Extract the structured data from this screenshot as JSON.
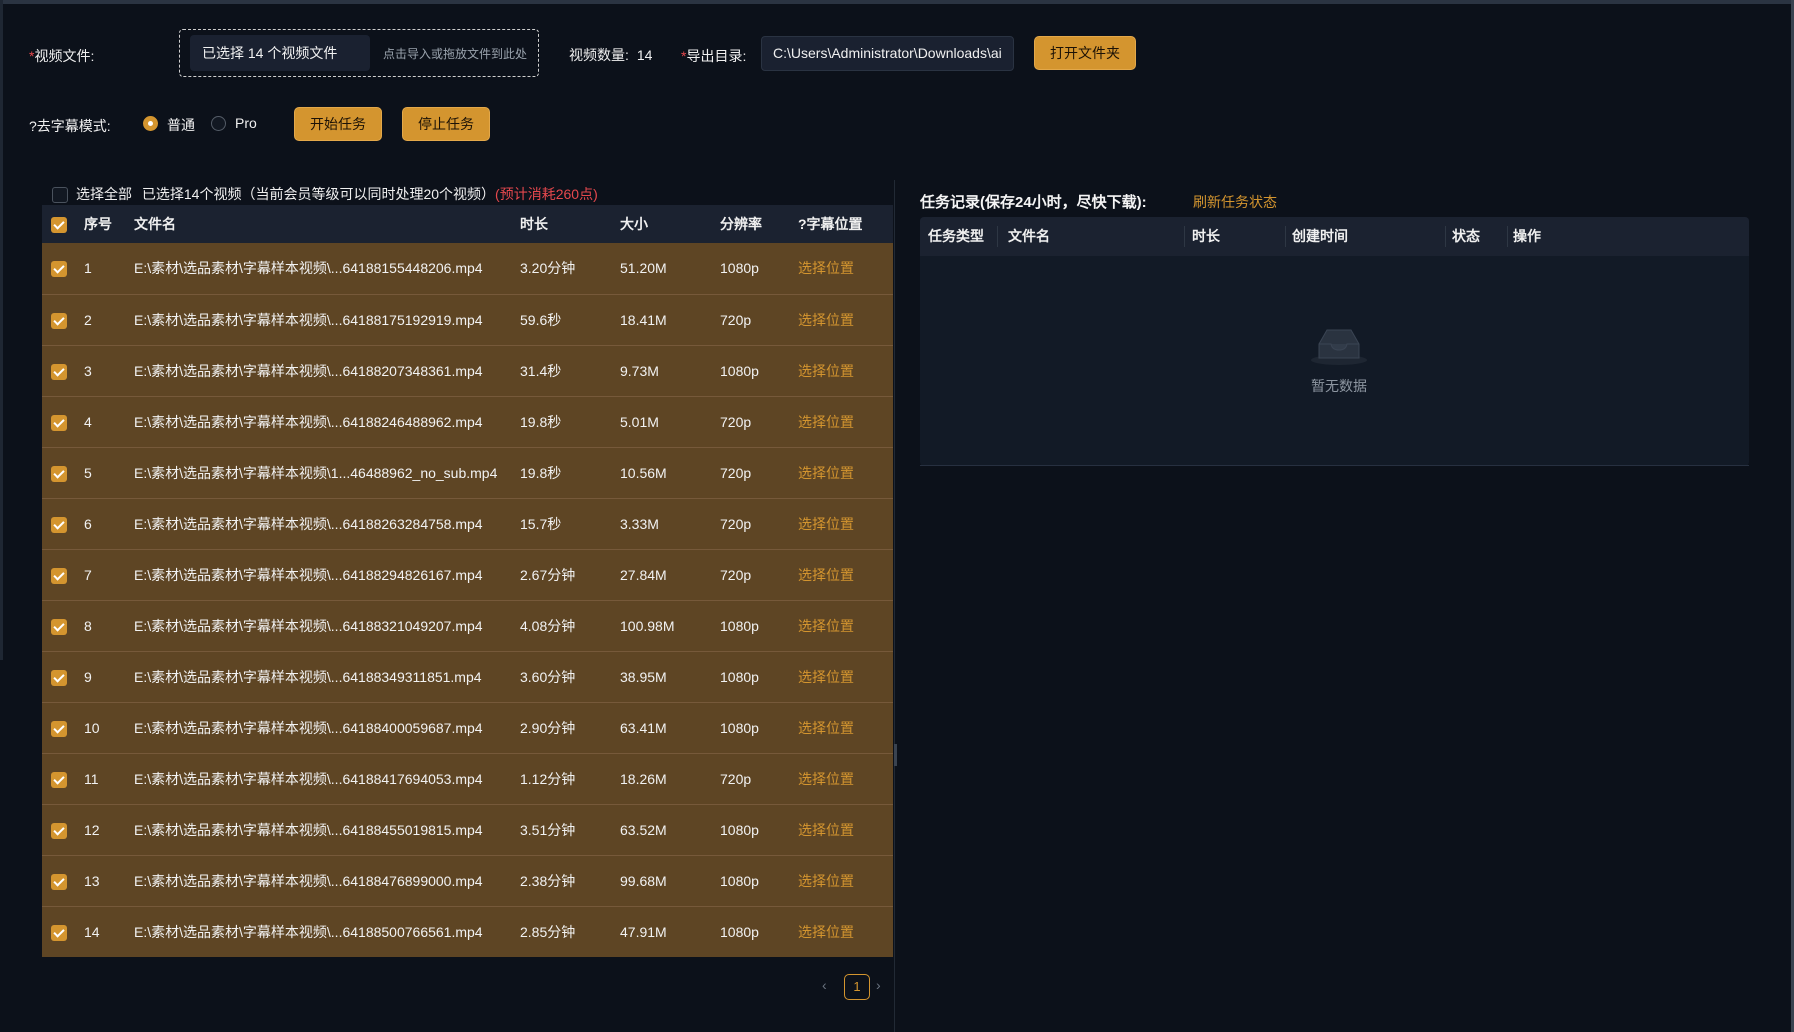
{
  "header": {
    "video_file_label": "视频文件:",
    "video_file_required": "*",
    "selected_files": "已选择 14 个视频文件",
    "drop_hint": "点击导入或拖放文件到此处",
    "video_count_label": "视频数量:",
    "video_count": "14",
    "export_dir_label": "导出目录:",
    "export_dir_required": "*",
    "export_dir_value": "C:\\Users\\Administrator\\Downloads\\ai",
    "open_folder_button": "打开文件夹"
  },
  "mode": {
    "label": "?去字幕模式:",
    "options": [
      "普通",
      "Pro"
    ],
    "selected": "普通",
    "start_button": "开始任务",
    "stop_button": "停止任务"
  },
  "list": {
    "select_all": "选择全部",
    "summary": "已选择14个视频（当前会员等级可以同时处理20个视频）",
    "cost": "(预计消耗260点)",
    "columns": [
      "序号",
      "文件名",
      "时长",
      "大小",
      "分辨率",
      "?字幕位置"
    ],
    "action_label": "选择位置",
    "rows": [
      {
        "idx": "1",
        "name": "E:\\素材\\选品素材\\字幕样本视频\\...64188155448206.mp4",
        "duration": "3.20分钟",
        "size": "51.20M",
        "res": "1080p"
      },
      {
        "idx": "2",
        "name": "E:\\素材\\选品素材\\字幕样本视频\\...64188175192919.mp4",
        "duration": "59.6秒",
        "size": "18.41M",
        "res": "720p"
      },
      {
        "idx": "3",
        "name": "E:\\素材\\选品素材\\字幕样本视频\\...64188207348361.mp4",
        "duration": "31.4秒",
        "size": "9.73M",
        "res": "1080p"
      },
      {
        "idx": "4",
        "name": "E:\\素材\\选品素材\\字幕样本视频\\...64188246488962.mp4",
        "duration": "19.8秒",
        "size": "5.01M",
        "res": "720p"
      },
      {
        "idx": "5",
        "name": "E:\\素材\\选品素材\\字幕样本视频\\1...46488962_no_sub.mp4",
        "duration": "19.8秒",
        "size": "10.56M",
        "res": "720p"
      },
      {
        "idx": "6",
        "name": "E:\\素材\\选品素材\\字幕样本视频\\...64188263284758.mp4",
        "duration": "15.7秒",
        "size": "3.33M",
        "res": "720p"
      },
      {
        "idx": "7",
        "name": "E:\\素材\\选品素材\\字幕样本视频\\...64188294826167.mp4",
        "duration": "2.67分钟",
        "size": "27.84M",
        "res": "720p"
      },
      {
        "idx": "8",
        "name": "E:\\素材\\选品素材\\字幕样本视频\\...64188321049207.mp4",
        "duration": "4.08分钟",
        "size": "100.98M",
        "res": "1080p"
      },
      {
        "idx": "9",
        "name": "E:\\素材\\选品素材\\字幕样本视频\\...64188349311851.mp4",
        "duration": "3.60分钟",
        "size": "38.95M",
        "res": "1080p"
      },
      {
        "idx": "10",
        "name": "E:\\素材\\选品素材\\字幕样本视频\\...64188400059687.mp4",
        "duration": "2.90分钟",
        "size": "63.41M",
        "res": "1080p"
      },
      {
        "idx": "11",
        "name": "E:\\素材\\选品素材\\字幕样本视频\\...64188417694053.mp4",
        "duration": "1.12分钟",
        "size": "18.26M",
        "res": "720p"
      },
      {
        "idx": "12",
        "name": "E:\\素材\\选品素材\\字幕样本视频\\...64188455019815.mp4",
        "duration": "3.51分钟",
        "size": "63.52M",
        "res": "1080p"
      },
      {
        "idx": "13",
        "name": "E:\\素材\\选品素材\\字幕样本视频\\...64188476899000.mp4",
        "duration": "2.38分钟",
        "size": "99.68M",
        "res": "1080p"
      },
      {
        "idx": "14",
        "name": "E:\\素材\\选品素材\\字幕样本视频\\...64188500766561.mp4",
        "duration": "2.85分钟",
        "size": "47.91M",
        "res": "1080p"
      }
    ],
    "pagination": {
      "current": "1",
      "prev_icon": "chevron-left-icon",
      "next_icon": "chevron-right-icon"
    }
  },
  "tasks": {
    "title": "任务记录(保存24小时，尽快下载):",
    "refresh": "刷新任务状态",
    "columns": [
      "任务类型",
      "文件名",
      "时长",
      "创建时间",
      "状态",
      "操作"
    ],
    "empty_text": "暂无数据",
    "empty_icon": "inbox-icon"
  },
  "colors": {
    "accent": "#d4952f",
    "row_bg": "#5e4524",
    "background": "#0c111a",
    "danger": "#e5484d"
  }
}
